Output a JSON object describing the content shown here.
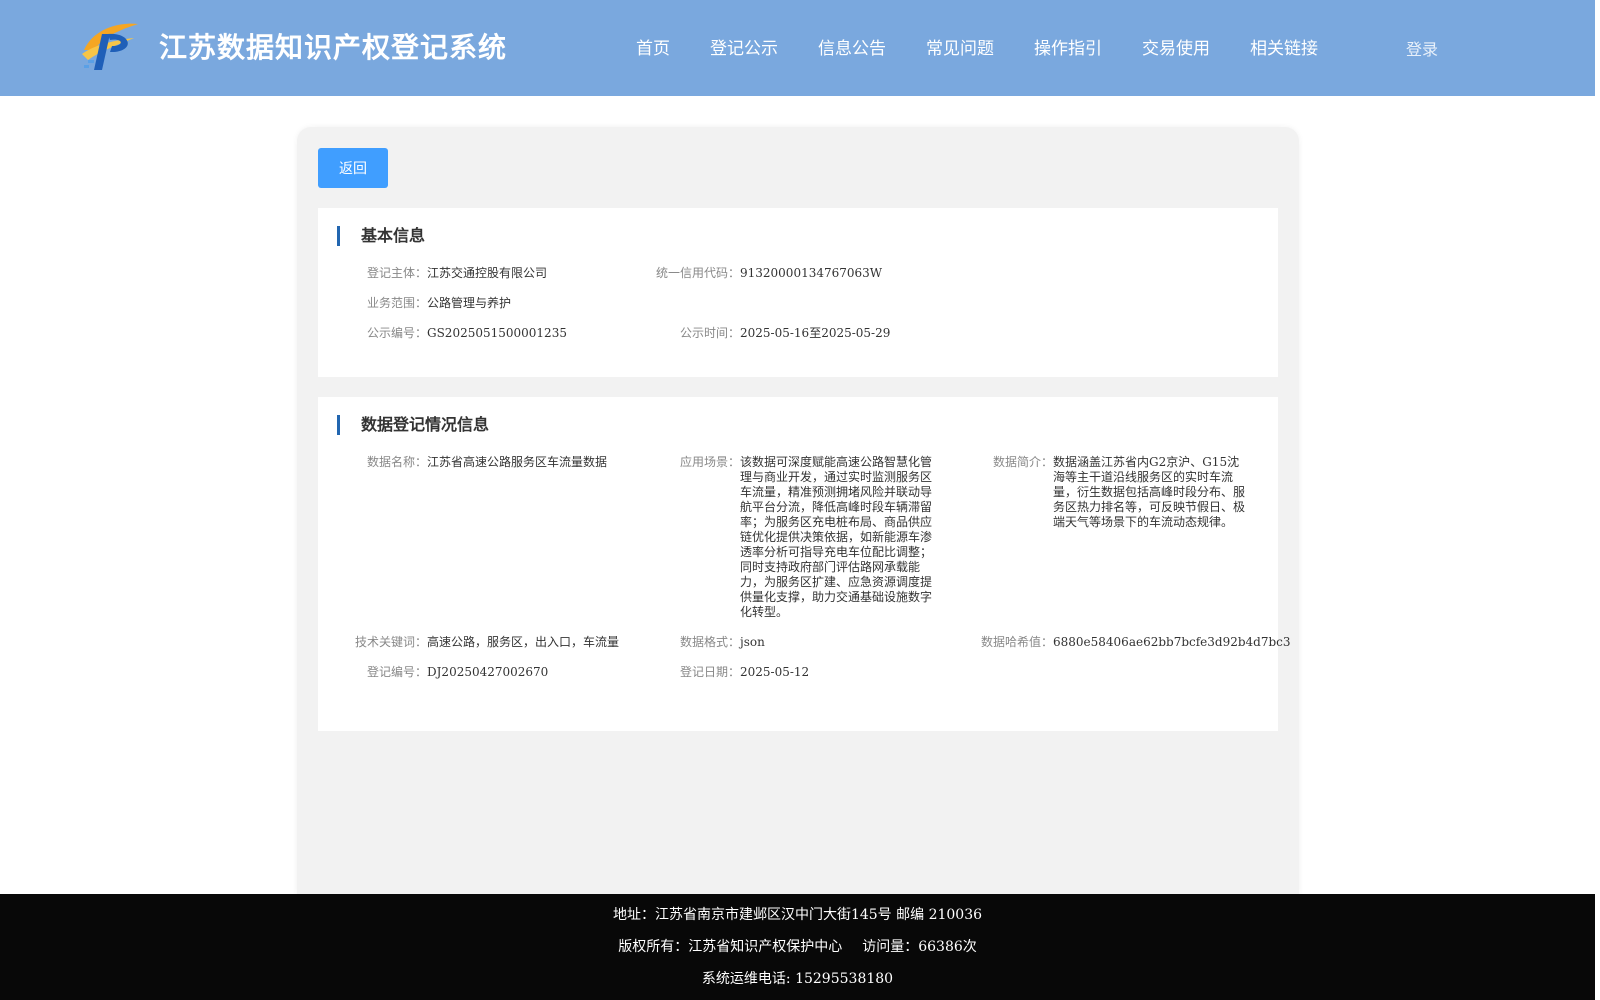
{
  "header": {
    "title": "江苏数据知识产权登记系统",
    "nav": [
      "首页",
      "登记公示",
      "信息公告",
      "常见问题",
      "操作指引",
      "交易使用",
      "相关链接"
    ],
    "login": "登录"
  },
  "back_label": "返回",
  "basic": {
    "title": "基本信息",
    "entity_label": "登记主体：",
    "entity": "江苏交通控股有限公司",
    "credit_label": "统一信用代码：",
    "credit": "91320000134767063W",
    "scope_label": "业务范围：",
    "scope": "公路管理与养护",
    "notice_no_label": "公示编号：",
    "notice_no": "GS2025051500001235",
    "notice_time_label": "公示时间：",
    "notice_time": "2025-05-16至2025-05-29"
  },
  "registration": {
    "title": "数据登记情况信息",
    "name_label": "数据名称：",
    "name": "江苏省高速公路服务区车流量数据",
    "scene_label": "应用场景：",
    "scene": "该数据可深度赋能高速公路智慧化管理与商业开发，通过实时监测服务区车流量，精准预测拥堵风险并联动导航平台分流，降低高峰时段车辆滞留率；为服务区充电桩布局、商品供应链优化提供决策依据，如新能源车渗透率分析可指导充电车位配比调整；同时支持政府部门评估路网承载能力，为服务区扩建、应急资源调度提供量化支撑，助力交通基础设施数字化转型。",
    "intro_label": "数据简介：",
    "intro": "数据涵盖江苏省内G2京沪、G15沈海等主干道沿线服务区的实时车流量，衍生数据包括高峰时段分布、服务区热力排名等，可反映节假日、极端天气等场景下的车流动态规律。",
    "keywords_label": "技术关键词：",
    "keywords": "高速公路，服务区，出入口，车流量",
    "format_label": "数据格式：",
    "format": "json",
    "hash_label": "数据哈希值：",
    "hash": "6880e58406ae62bb7bcfe3d92b4d7bc3",
    "reg_no_label": "登记编号：",
    "reg_no": "DJ20250427002670",
    "reg_date_label": "登记日期：",
    "reg_date": "2025-05-12"
  },
  "footer": {
    "address": "地址：江苏省南京市建邺区汉中门大街145号 邮编 210036",
    "copyright": "版权所有：江苏省知识产权保护中心",
    "visits": "访问量：66386次",
    "phone": "系统运维电话: 15295538180"
  },
  "colors": {
    "header_bg": "#7aa8de",
    "button": "#409eff",
    "accent_bar": "#2266b0",
    "footer_bg": "#080808"
  }
}
